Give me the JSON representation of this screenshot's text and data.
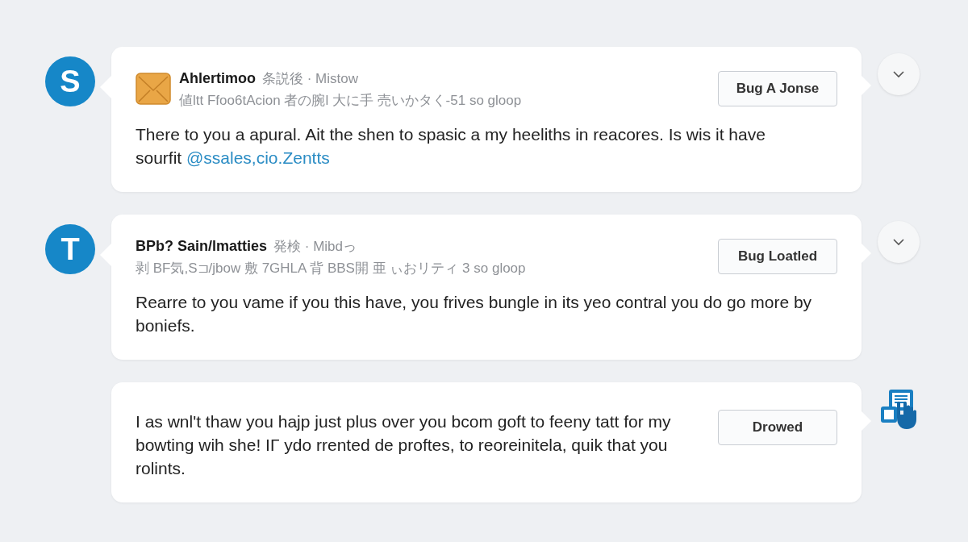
{
  "messages": [
    {
      "kind": "mail",
      "avatar": "S",
      "name": "Ahlertimoo",
      "meta": "条説後 · Mistow",
      "subline": "値ltt Ffoo6tAcion 者の腕l 大に手 売いかタく-51 so gloop",
      "button": "Bug A Jonse",
      "body": "There to you a apural. Ait the shen to spasic a my heeliths in reacores. Is wis it have sourfit",
      "link": "@ssales,cio.Zentts",
      "side": {
        "kind": "expand"
      }
    },
    {
      "kind": "plain",
      "avatar": "T",
      "name": "BPb? Sain/lmatties",
      "meta": "発検 · Mibdっ",
      "subline": "剥 BF気,S⊐/jbow 敷 7GHLA 背 BBS開 亜 ぃおリティ 3 so gloop",
      "button": "Bug Loatled",
      "body": "Rearre to you vame if you this have, you frives bungle in its yeo contral you do go more by boniefs.",
      "side": {
        "kind": "expand"
      }
    },
    {
      "kind": "note",
      "button": "Drowed",
      "body": "I as wnl't thaw you hajp just plus over you bcom goft to feeny tatt for my bowting wih she! IΓ ydo rrented de proftes, to reoreinitela, quik that you rolints.",
      "side": {
        "kind": "document"
      }
    }
  ]
}
